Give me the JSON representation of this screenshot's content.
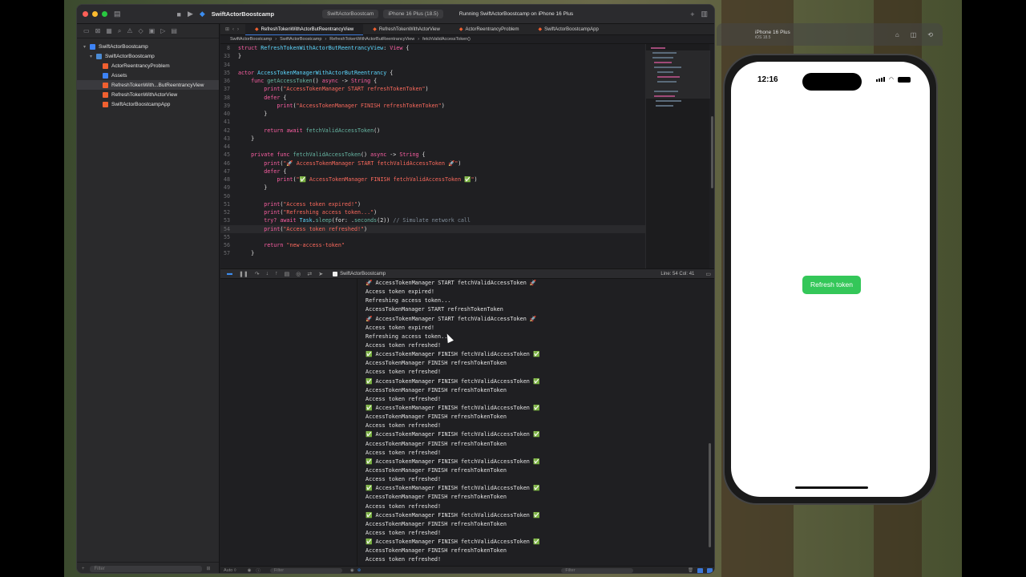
{
  "colors": {
    "accent": "#3c78d8",
    "green_button": "#34c759",
    "swift_orange": "#f06030"
  },
  "xcode": {
    "scheme": "SwiftActorBoostcamp",
    "toolbar_chips": [
      "SwiftActorBoostcam",
      "iPhone 16 Plus (18.5)"
    ],
    "status": "Running SwiftActorBoostcamp on iPhone 16 Plus",
    "navigator": [
      {
        "label": "SwiftActorBoostcamp",
        "icon": "project-icon",
        "level": 0,
        "disclosure": "▾"
      },
      {
        "label": "SwiftActorBoostcamp",
        "icon": "folder-icon",
        "level": 1,
        "disclosure": "▾"
      },
      {
        "label": "ActorReentrancyProblem",
        "icon": "swift-file-icon",
        "level": 2
      },
      {
        "label": "Assets",
        "icon": "assets-icon",
        "level": 2
      },
      {
        "label": "RefreshTokenWith...ButReentrancyView",
        "icon": "swift-file-icon",
        "level": 2,
        "selected": true
      },
      {
        "label": "RefreshTokenWithActorView",
        "icon": "swift-file-icon",
        "level": 2
      },
      {
        "label": "SwiftActorBoostcampApp",
        "icon": "swift-file-icon",
        "level": 2
      }
    ],
    "sidebar_filter": "Filter",
    "tabs": [
      {
        "label": "RefreshTokenWithActorButReentrancyView",
        "active": true
      },
      {
        "label": "RefreshTokenWithActorView"
      },
      {
        "label": "ActorReentrancyProblem"
      },
      {
        "label": "SwiftActorBoostcampApp"
      }
    ],
    "jumpbar": [
      "SwiftActorBoostcamp",
      "SwiftActorBoostcamp",
      "RefreshTokenWithActorButReentrancyView",
      "fetchValidAccessToken()"
    ],
    "code_lines": [
      {
        "n": "8",
        "tokens": [
          [
            "kw",
            "struct "
          ],
          [
            "ty",
            "RefreshTokenWithActorButReentrancyView"
          ],
          [
            "pl",
            ": "
          ],
          [
            "kw",
            "View"
          ],
          [
            "pl",
            " {"
          ]
        ]
      },
      {
        "n": "33",
        "tokens": [
          [
            "pl",
            "}"
          ]
        ]
      },
      {
        "n": "34",
        "tokens": []
      },
      {
        "n": "35",
        "tokens": [
          [
            "kw",
            "actor "
          ],
          [
            "ty",
            "AccessTokenManagerWithActorButReentrancy"
          ],
          [
            "pl",
            " {"
          ]
        ]
      },
      {
        "n": "36",
        "tokens": [
          [
            "pl",
            "    "
          ],
          [
            "kw",
            "func "
          ],
          [
            "fn",
            "getAccessToken"
          ],
          [
            "pl",
            "() "
          ],
          [
            "kw",
            "async"
          ],
          [
            "pl",
            " -> "
          ],
          [
            "kw",
            "String"
          ],
          [
            "pl",
            " {"
          ]
        ]
      },
      {
        "n": "37",
        "tokens": [
          [
            "pl",
            "        "
          ],
          [
            "kw",
            "print"
          ],
          [
            "pl",
            "("
          ],
          [
            "st",
            "\"AccessTokenManager START refreshTokenToken\""
          ],
          [
            "pl",
            ")"
          ]
        ]
      },
      {
        "n": "38",
        "tokens": [
          [
            "pl",
            "        "
          ],
          [
            "kw",
            "defer"
          ],
          [
            "pl",
            " {"
          ]
        ]
      },
      {
        "n": "39",
        "tokens": [
          [
            "pl",
            "            "
          ],
          [
            "kw",
            "print"
          ],
          [
            "pl",
            "("
          ],
          [
            "st",
            "\"AccessTokenManager FINISH refreshTokenToken\""
          ],
          [
            "pl",
            ")"
          ]
        ]
      },
      {
        "n": "40",
        "tokens": [
          [
            "pl",
            "        }"
          ]
        ]
      },
      {
        "n": "41",
        "tokens": []
      },
      {
        "n": "42",
        "tokens": [
          [
            "pl",
            "        "
          ],
          [
            "kw",
            "return await "
          ],
          [
            "fn",
            "fetchValidAccessToken"
          ],
          [
            "pl",
            "()"
          ]
        ]
      },
      {
        "n": "43",
        "tokens": [
          [
            "pl",
            "    }"
          ]
        ]
      },
      {
        "n": "44",
        "tokens": []
      },
      {
        "n": "45",
        "tokens": [
          [
            "pl",
            "    "
          ],
          [
            "kw",
            "private func "
          ],
          [
            "fn",
            "fetchValidAccessToken"
          ],
          [
            "pl",
            "() "
          ],
          [
            "kw",
            "async"
          ],
          [
            "pl",
            " -> "
          ],
          [
            "kw",
            "String"
          ],
          [
            "pl",
            " {"
          ]
        ]
      },
      {
        "n": "46",
        "tokens": [
          [
            "pl",
            "        "
          ],
          [
            "kw",
            "print"
          ],
          [
            "pl",
            "("
          ],
          [
            "st",
            "\"🚀 AccessTokenManager START fetchValidAccessToken 🚀\""
          ],
          [
            "pl",
            ")"
          ]
        ]
      },
      {
        "n": "47",
        "tokens": [
          [
            "pl",
            "        "
          ],
          [
            "kw",
            "defer"
          ],
          [
            "pl",
            " {"
          ]
        ]
      },
      {
        "n": "48",
        "tokens": [
          [
            "pl",
            "            "
          ],
          [
            "kw",
            "print"
          ],
          [
            "pl",
            "("
          ],
          [
            "st",
            "\"✅ AccessTokenManager FINISH fetchValidAccessToken ✅\""
          ],
          [
            "pl",
            ")"
          ]
        ]
      },
      {
        "n": "49",
        "tokens": [
          [
            "pl",
            "        }"
          ]
        ]
      },
      {
        "n": "50",
        "tokens": []
      },
      {
        "n": "51",
        "tokens": [
          [
            "pl",
            "        "
          ],
          [
            "kw",
            "print"
          ],
          [
            "pl",
            "("
          ],
          [
            "st",
            "\"Access token expired!\""
          ],
          [
            "pl",
            ")"
          ]
        ]
      },
      {
        "n": "52",
        "tokens": [
          [
            "pl",
            "        "
          ],
          [
            "kw",
            "print"
          ],
          [
            "pl",
            "("
          ],
          [
            "st",
            "\"Refreshing access token...\""
          ],
          [
            "pl",
            ")"
          ]
        ]
      },
      {
        "n": "53",
        "tokens": [
          [
            "pl",
            "        "
          ],
          [
            "kw",
            "try? await "
          ],
          [
            "ty",
            "Task"
          ],
          [
            "pl",
            "."
          ],
          [
            "fn",
            "sleep"
          ],
          [
            "pl",
            "(for: ."
          ],
          [
            "fn",
            "seconds"
          ],
          [
            "pl",
            "(2)) "
          ],
          [
            "cm",
            "// Simulate network call"
          ]
        ]
      },
      {
        "n": "54",
        "tokens": [
          [
            "pl",
            "        "
          ],
          [
            "kw",
            "print"
          ],
          [
            "pl",
            "("
          ],
          [
            "st",
            "\"Access token refreshed!\""
          ],
          [
            "pl",
            ")"
          ]
        ],
        "current": true
      },
      {
        "n": "55",
        "tokens": []
      },
      {
        "n": "56",
        "tokens": [
          [
            "pl",
            "        "
          ],
          [
            "kw",
            "return "
          ],
          [
            "st",
            "\"new-access-token\""
          ]
        ]
      },
      {
        "n": "57",
        "tokens": [
          [
            "pl",
            "    }"
          ]
        ]
      }
    ],
    "debug_app": "SwiftActorBoostcamp",
    "line_col": "Line: 54  Col: 41",
    "console_lines": [
      "🚀 AccessTokenManager START fetchValidAccessToken 🚀",
      "Access token expired!",
      "Refreshing access token...",
      "AccessTokenManager START refreshTokenToken",
      "🚀 AccessTokenManager START fetchValidAccessToken 🚀",
      "Access token expired!",
      "Refreshing access token...",
      "Access token refreshed!",
      "✅ AccessTokenManager FINISH fetchValidAccessToken ✅",
      "AccessTokenManager FINISH refreshTokenToken",
      "Access token refreshed!",
      "✅ AccessTokenManager FINISH fetchValidAccessToken ✅",
      "AccessTokenManager FINISH refreshTokenToken",
      "Access token refreshed!",
      "✅ AccessTokenManager FINISH fetchValidAccessToken ✅",
      "AccessTokenManager FINISH refreshTokenToken",
      "Access token refreshed!",
      "✅ AccessTokenManager FINISH fetchValidAccessToken ✅",
      "AccessTokenManager FINISH refreshTokenToken",
      "Access token refreshed!",
      "✅ AccessTokenManager FINISH fetchValidAccessToken ✅",
      "AccessTokenManager FINISH refreshTokenToken",
      "Access token refreshed!",
      "✅ AccessTokenManager FINISH fetchValidAccessToken ✅",
      "AccessTokenManager FINISH refreshTokenToken",
      "Access token refreshed!",
      "✅ AccessTokenManager FINISH fetchValidAccessToken ✅",
      "AccessTokenManager FINISH refreshTokenToken",
      "Access token refreshed!",
      "✅ AccessTokenManager FINISH fetchValidAccessToken ✅",
      "AccessTokenManager FINISH refreshTokenToken",
      "Access token refreshed!"
    ],
    "bottom_auto": "Auto ◊",
    "bottom_filter": "Filter"
  },
  "simulator": {
    "device": "iPhone 16 Plus",
    "os": "iOS 18.5",
    "time": "12:16",
    "button_label": "Refresh token"
  }
}
